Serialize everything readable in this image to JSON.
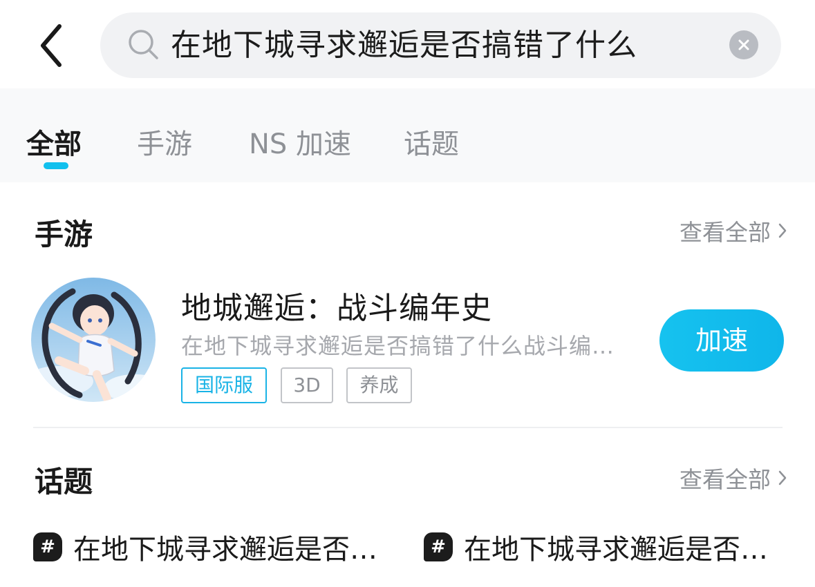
{
  "search": {
    "query": "在地下城寻求邂逅是否搞错了什么"
  },
  "tabs": [
    {
      "label": "全部",
      "active": true
    },
    {
      "label": "手游",
      "active": false
    },
    {
      "label": "NS 加速",
      "active": false
    },
    {
      "label": "话题",
      "active": false
    }
  ],
  "mobile_games": {
    "title": "手游",
    "view_all": "查看全部",
    "items": [
      {
        "name": "地城邂逅：战斗编年史",
        "description": "在地下城寻求邂逅是否搞错了什么战斗编…",
        "tags": [
          "国际服",
          "3D",
          "养成"
        ],
        "action": "加速"
      }
    ]
  },
  "topics": {
    "title": "话题",
    "view_all": "查看全部",
    "items": [
      {
        "label": "在地下城寻求邂逅是否…"
      },
      {
        "label": "在地下城寻求邂逅是否…"
      }
    ],
    "icon_text": "#"
  },
  "colors": {
    "accent": "#11c0ee",
    "tag_primary": "#19b3e6"
  }
}
